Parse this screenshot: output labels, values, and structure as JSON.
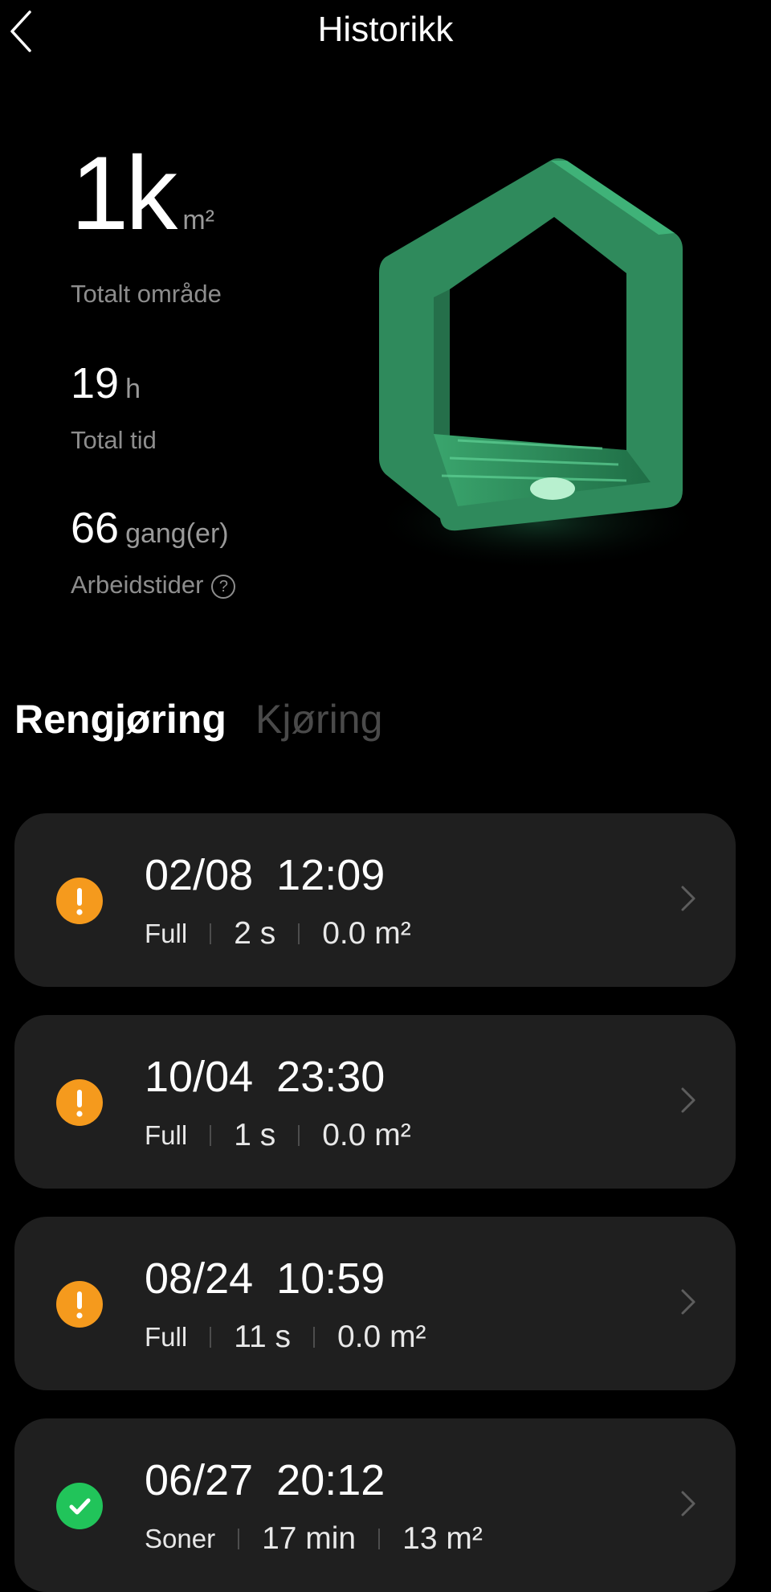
{
  "header": {
    "title": "Historikk"
  },
  "stats": {
    "total_area": {
      "value": "1k",
      "unit": "m²",
      "label": "Totalt område"
    },
    "total_time": {
      "value": "19",
      "unit": "h",
      "label": "Total tid"
    },
    "work_count": {
      "value": "66",
      "unit": "gang(er)",
      "label": "Arbeidstider"
    }
  },
  "tabs": [
    {
      "label": "Rengjøring",
      "active": true
    },
    {
      "label": "Kjøring",
      "active": false
    }
  ],
  "records": [
    {
      "date": "02/08",
      "time": "12:09",
      "mode": "Full",
      "duration": "2 s",
      "area": "0.0 m²",
      "status": "warning"
    },
    {
      "date": "10/04",
      "time": "23:30",
      "mode": "Full",
      "duration": "1 s",
      "area": "0.0 m²",
      "status": "warning"
    },
    {
      "date": "08/24",
      "time": "10:59",
      "mode": "Full",
      "duration": "11 s",
      "area": "0.0 m²",
      "status": "warning"
    },
    {
      "date": "06/27",
      "time": "20:12",
      "mode": "Soner",
      "duration": "17 min",
      "area": "13 m²",
      "status": "success"
    }
  ],
  "colors": {
    "warning": "#f59a1d",
    "success": "#21c45a",
    "house": "#2e8c5c"
  },
  "icons": {
    "back": "chevron-left-icon",
    "help": "help-circle-icon",
    "warning": "exclamation-icon",
    "success": "check-icon",
    "row": "chevron-right-icon"
  }
}
